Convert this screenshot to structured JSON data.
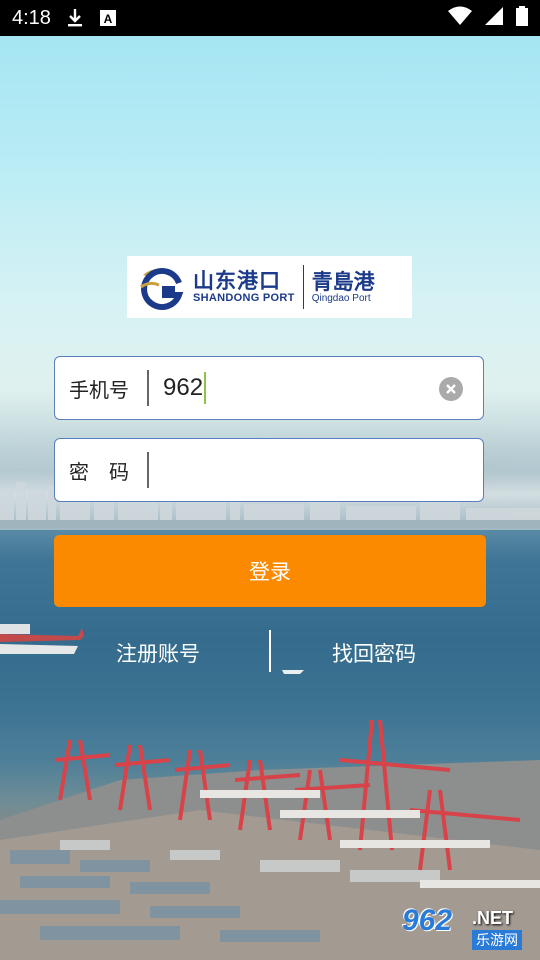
{
  "status_bar": {
    "time": "4:18",
    "icons": [
      "download-icon",
      "a-notification-icon",
      "wifi-icon",
      "signal-icon",
      "battery-icon"
    ]
  },
  "logo": {
    "shandong_cn": "山东港口",
    "shandong_en": "SHANDONG PORT",
    "qingdao_cn": "青島港",
    "qingdao_en": "Qingdao Port",
    "brand_color": "#1c3a8a"
  },
  "form": {
    "phone": {
      "label": "手机号",
      "value": "962",
      "clear_icon": "clear-icon"
    },
    "password": {
      "label": "密　码",
      "value": ""
    }
  },
  "actions": {
    "login_label": "登录",
    "login_color": "#fb8a00",
    "register_label": "注册账号",
    "recover_label": "找回密码"
  },
  "watermark": {
    "number": "962",
    "suffix": ".NET",
    "site": "乐游网"
  }
}
